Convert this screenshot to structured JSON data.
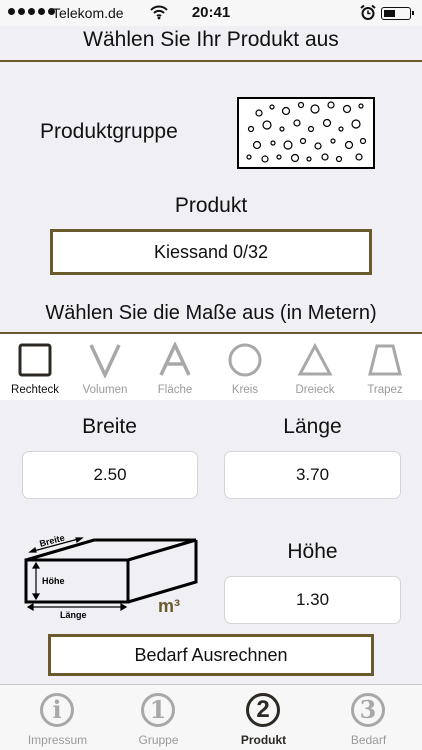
{
  "status_bar": {
    "carrier": "Telekom.de",
    "time": "20:41"
  },
  "header": {
    "title": "Wählen Sie Ihr Produkt aus"
  },
  "product_group": {
    "label": "Produktgruppe"
  },
  "product": {
    "label": "Produkt",
    "selected": "Kiessand 0/32"
  },
  "dimensions": {
    "title": "Wählen Sie die Maße aus (in Metern)",
    "shapes": [
      {
        "label": "Rechteck",
        "icon": "square-icon",
        "active": true
      },
      {
        "label": "Volumen",
        "icon": "letter-v-icon"
      },
      {
        "label": "Fläche",
        "icon": "letter-a-icon"
      },
      {
        "label": "Kreis",
        "icon": "circle-icon"
      },
      {
        "label": "Dreieck",
        "icon": "triangle-icon"
      },
      {
        "label": "Trapez",
        "icon": "trapezoid-icon"
      }
    ],
    "breite": {
      "label": "Breite",
      "value": "2.50"
    },
    "laenge": {
      "label": "Länge",
      "value": "3.70"
    },
    "hoehe": {
      "label": "Höhe",
      "value": "1.30"
    }
  },
  "diagram": {
    "breite": "Breite",
    "hoehe": "Höhe",
    "laenge": "Länge",
    "unit": "m³"
  },
  "calc_button": {
    "label": "Bedarf Ausrechnen"
  },
  "tab_bar": {
    "items": [
      {
        "glyph": "i",
        "label": "Impressum"
      },
      {
        "glyph": "1",
        "label": "Gruppe"
      },
      {
        "glyph": "2",
        "label": "Produkt",
        "active": true
      },
      {
        "glyph": "3",
        "label": "Bedarf"
      }
    ]
  },
  "colors": {
    "accent": "#6b5a2e",
    "background": "#efeff4",
    "inactive": "#a8a8a8"
  }
}
